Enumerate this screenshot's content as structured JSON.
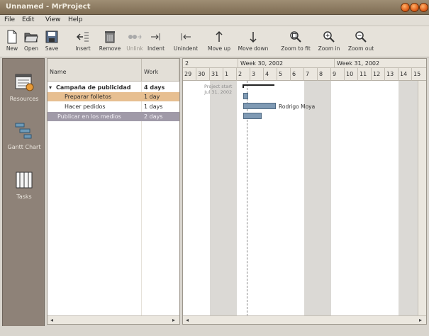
{
  "window": {
    "title": "Unnamed - MrProject"
  },
  "menubar": [
    "File",
    "Edit",
    "View",
    "Help"
  ],
  "toolbar": [
    {
      "label": "New",
      "icon": "new-document-icon",
      "enabled": true
    },
    {
      "label": "Open",
      "icon": "open-folder-icon",
      "enabled": true
    },
    {
      "label": "Save",
      "icon": "save-icon",
      "enabled": true
    },
    {
      "label": "Insert",
      "icon": "insert-task-icon",
      "enabled": true
    },
    {
      "label": "Remove",
      "icon": "remove-task-icon",
      "enabled": true
    },
    {
      "label": "Unlink",
      "icon": "unlink-icon",
      "enabled": false
    },
    {
      "label": "Indent",
      "icon": "indent-icon",
      "enabled": true
    },
    {
      "label": "Unindent",
      "icon": "unindent-icon",
      "enabled": true
    },
    {
      "label": "Move up",
      "icon": "move-up-icon",
      "enabled": true
    },
    {
      "label": "Move down",
      "icon": "move-down-icon",
      "enabled": true
    },
    {
      "label": "Zoom to fit",
      "icon": "zoom-fit-icon",
      "enabled": true
    },
    {
      "label": "Zoom in",
      "icon": "zoom-in-icon",
      "enabled": true
    },
    {
      "label": "Zoom out",
      "icon": "zoom-out-icon",
      "enabled": true
    }
  ],
  "sidebar": {
    "items": [
      {
        "label": "Resources",
        "icon": "resources-icon"
      },
      {
        "label": "Gantt Chart",
        "icon": "gantt-chart-icon"
      },
      {
        "label": "Tasks",
        "icon": "tasks-icon"
      }
    ]
  },
  "task_table": {
    "columns": [
      "Name",
      "Work"
    ],
    "rows": [
      {
        "name": "Campaña de publicidad",
        "work": "4 days",
        "level": 0,
        "expanded": true,
        "bold": true
      },
      {
        "name": "Preparar folletos",
        "work": "1 day",
        "level": 1,
        "selected": "orange"
      },
      {
        "name": "Hacer pedidos",
        "work": "1 days",
        "level": 1
      },
      {
        "name": "Publicar en los medios",
        "work": "2 days",
        "level": 1,
        "selected": "purple"
      }
    ]
  },
  "gantt": {
    "weeks": [
      "2",
      "Week 30, 2002",
      "Week 31, 2002"
    ],
    "days": [
      "29",
      "30",
      "31",
      "1",
      "2",
      "3",
      "4",
      "5",
      "6",
      "7",
      "8",
      "9",
      "10",
      "11",
      "12",
      "13",
      "14",
      "15"
    ],
    "project_start_label": "Project start",
    "project_start_date": "Jul 31, 2002",
    "resource_label": "Rodrigo Moya"
  },
  "colors": {
    "titlebar": "#8d7b61",
    "selected_orange": "#e7bf91",
    "selected_purple": "#a09aa8",
    "bar": "#7f9ab4",
    "weekend": "#dbd9d5"
  }
}
